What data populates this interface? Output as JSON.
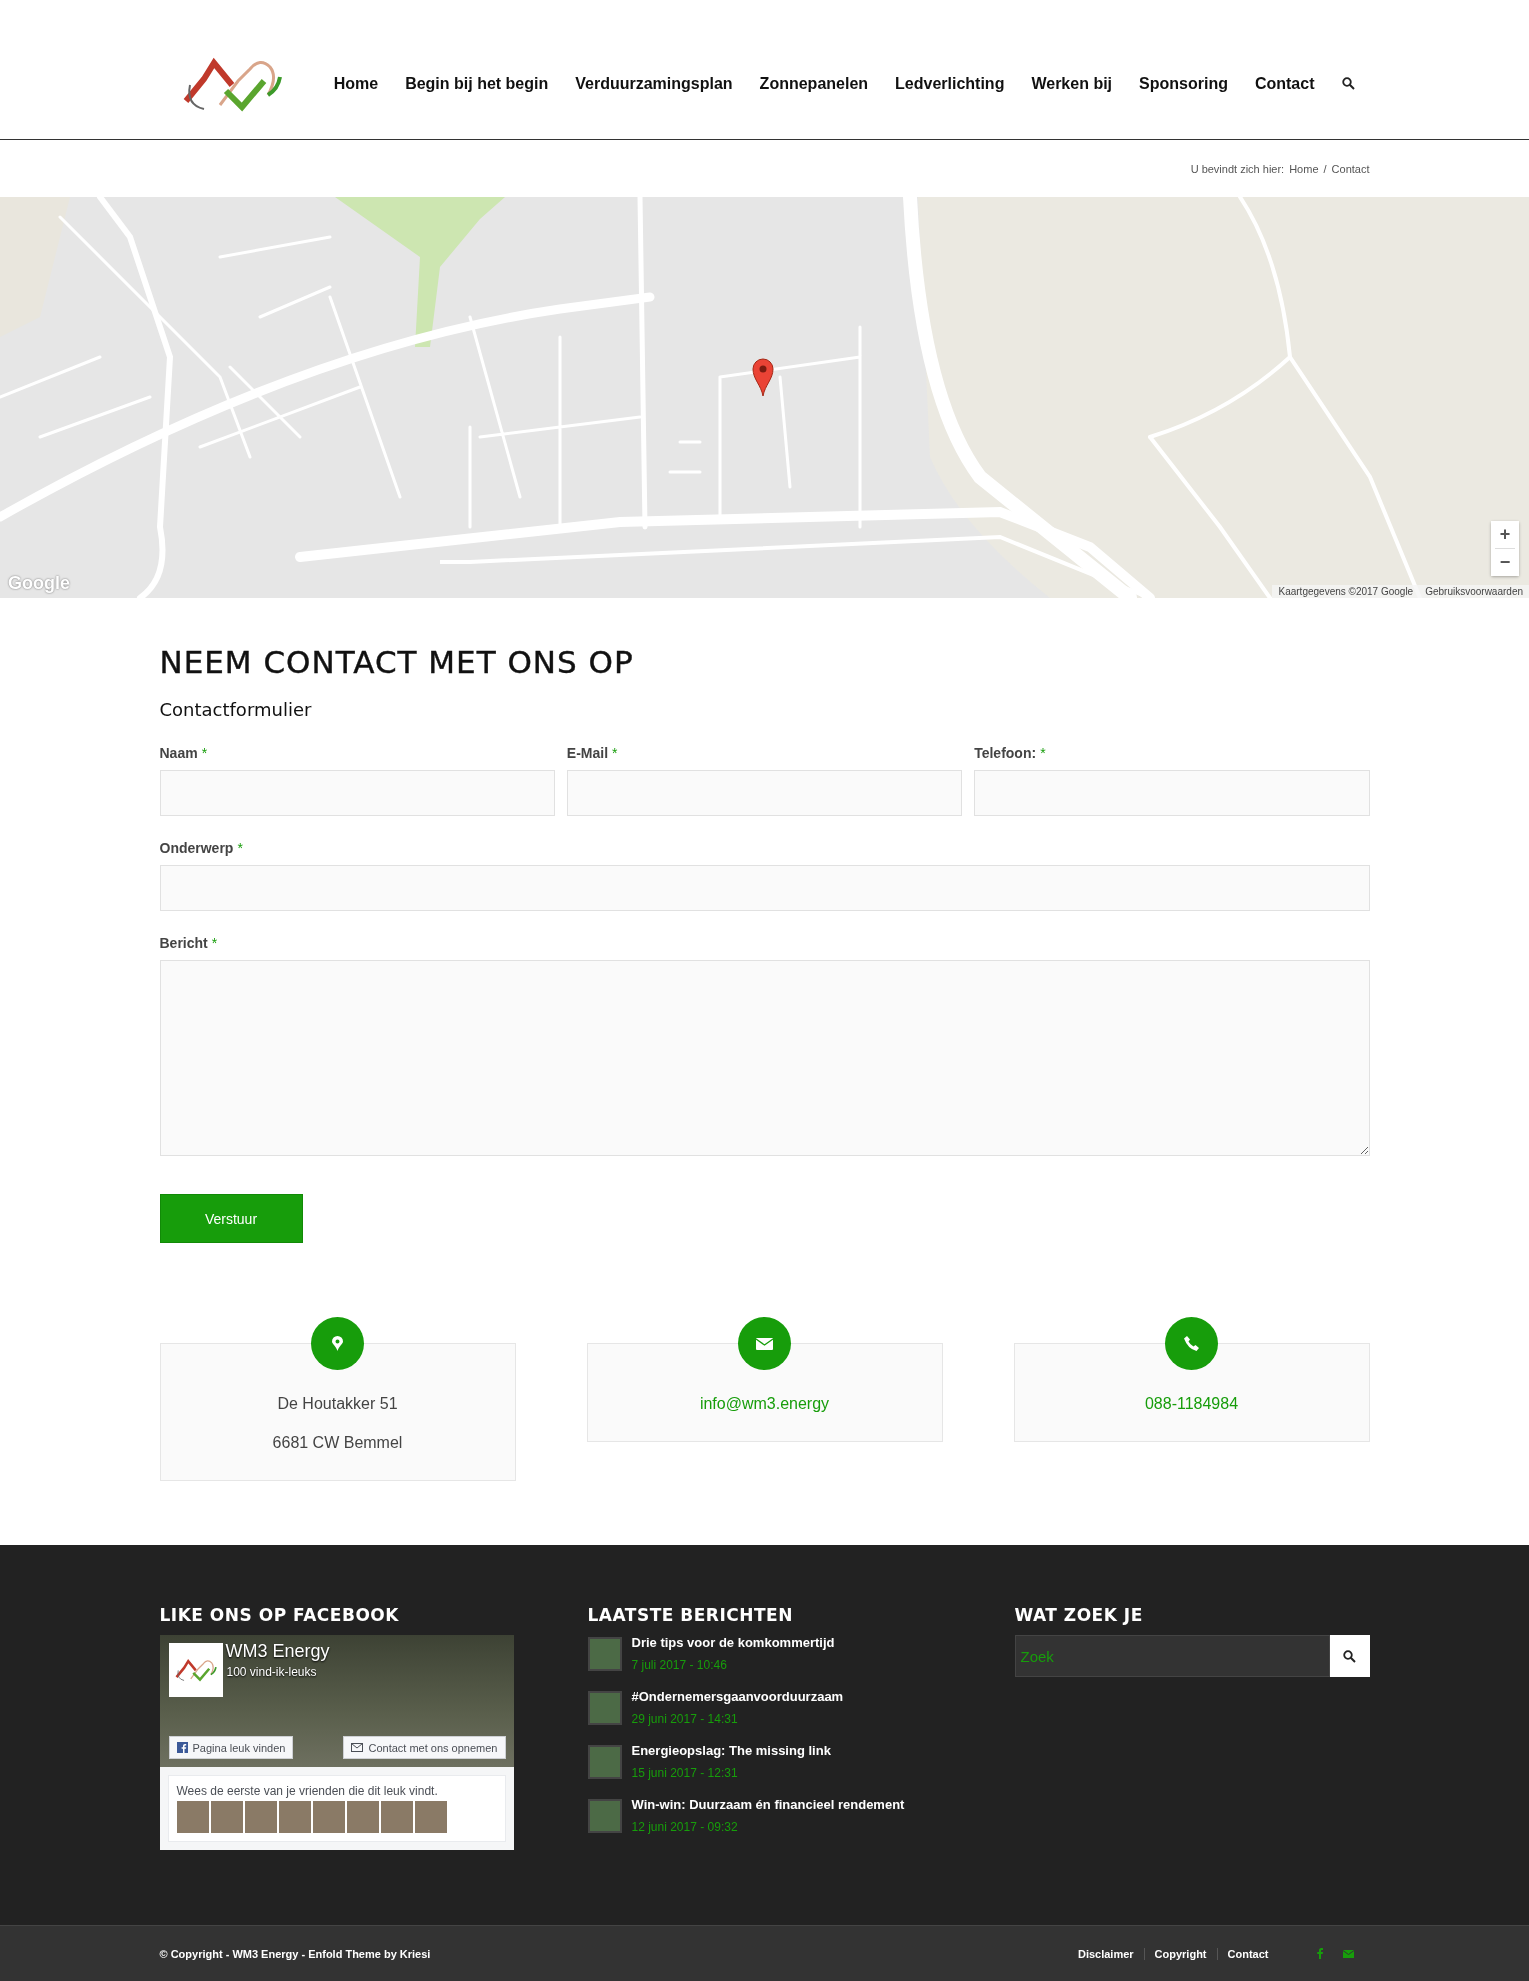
{
  "header": {
    "nav": [
      "Home",
      "Begin bij het begin",
      "Verduurzamingsplan",
      "Zonnepanelen",
      "Ledverlichting",
      "Werken bij",
      "Sponsoring",
      "Contact"
    ]
  },
  "breadcrumb": {
    "label": "U bevindt zich hier:",
    "items": [
      "Home",
      "Contact"
    ],
    "separator": "/"
  },
  "map": {
    "logo": "Google",
    "attribution": "Kaartgegevens ©2017 Google",
    "terms": "Gebruiksvoorwaarden",
    "zoom_in": "+",
    "zoom_out": "−"
  },
  "contact": {
    "title": "NEEM CONTACT MET ONS OP",
    "subtitle": "Contactformulier",
    "fields": [
      {
        "label": "Naam",
        "required_mark": "*",
        "kind": "input"
      },
      {
        "label": "E-Mail",
        "required_mark": "*",
        "kind": "input"
      },
      {
        "label": "Telefoon:",
        "required_mark": "*",
        "kind": "input"
      },
      {
        "label": "Onderwerp",
        "required_mark": "*",
        "kind": "input"
      },
      {
        "label": "Bericht",
        "required_mark": "*",
        "kind": "textarea"
      }
    ],
    "submit": "Verstuur"
  },
  "info_cards": [
    {
      "kind": "address",
      "lines": [
        "De Houtakker 51",
        "6681 CW Bemmel"
      ]
    },
    {
      "kind": "email",
      "lines": [
        "info@wm3.energy"
      ]
    },
    {
      "kind": "phone",
      "lines": [
        "088-1184984"
      ]
    }
  ],
  "footer": {
    "facebook": {
      "title": "LIKE ONS OP FACEBOOK",
      "page_name": "WM3 Energy",
      "likes": "100 vind-ik-leuks",
      "like_button": "Pagina leuk vinden",
      "contact_button": "Contact met ons opnemen",
      "friends_text": "Wees de eerste van je vrienden die dit leuk vindt."
    },
    "posts": {
      "title": "LAATSTE BERICHTEN",
      "items": [
        {
          "title": "Drie tips voor de komkommertijd",
          "date": "7 juli 2017 - 10:46"
        },
        {
          "title": "#Ondernemersgaanvoorduurzaam",
          "date": "29 juni 2017 - 14:31"
        },
        {
          "title": "Energieopslag: The missing link",
          "date": "15 juni 2017 - 12:31"
        },
        {
          "title": "Win-win: Duurzaam én financieel rendement",
          "date": "12 juni 2017 - 09:32"
        }
      ]
    },
    "search": {
      "title": "WAT ZOEK JE",
      "placeholder": "Zoek"
    }
  },
  "bottom_bar": {
    "copyright": "© Copyright - WM3 Energy - Enfold Theme by Kriesi",
    "links": [
      "Disclaimer",
      "Copyright",
      "Contact"
    ]
  }
}
